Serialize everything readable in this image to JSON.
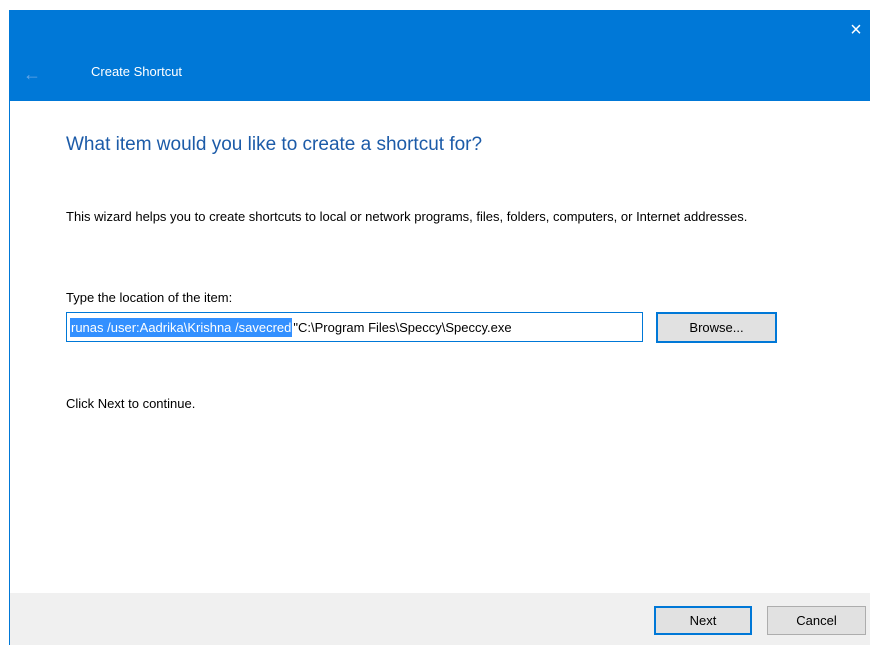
{
  "window": {
    "title": "Create Shortcut",
    "close_icon": "×",
    "back_icon": "←"
  },
  "main": {
    "heading": "What item would you like to create a shortcut for?",
    "description": "This wizard helps you to create shortcuts to local or network programs, files, folders, computers, or Internet addresses.",
    "field_label": "Type the location of the item:",
    "location_selected": "runas /user:Aadrika\\Krishna /savecred ",
    "location_rest": "\"C:\\Program Files\\Speccy\\Speccy.exe",
    "browse_label": "Browse...",
    "hint": "Click Next to continue."
  },
  "footer": {
    "next_label": "Next",
    "cancel_label": "Cancel"
  },
  "colors": {
    "titlebar": "#0078d7",
    "heading": "#1c5ba8",
    "selection": "#3390ff"
  }
}
